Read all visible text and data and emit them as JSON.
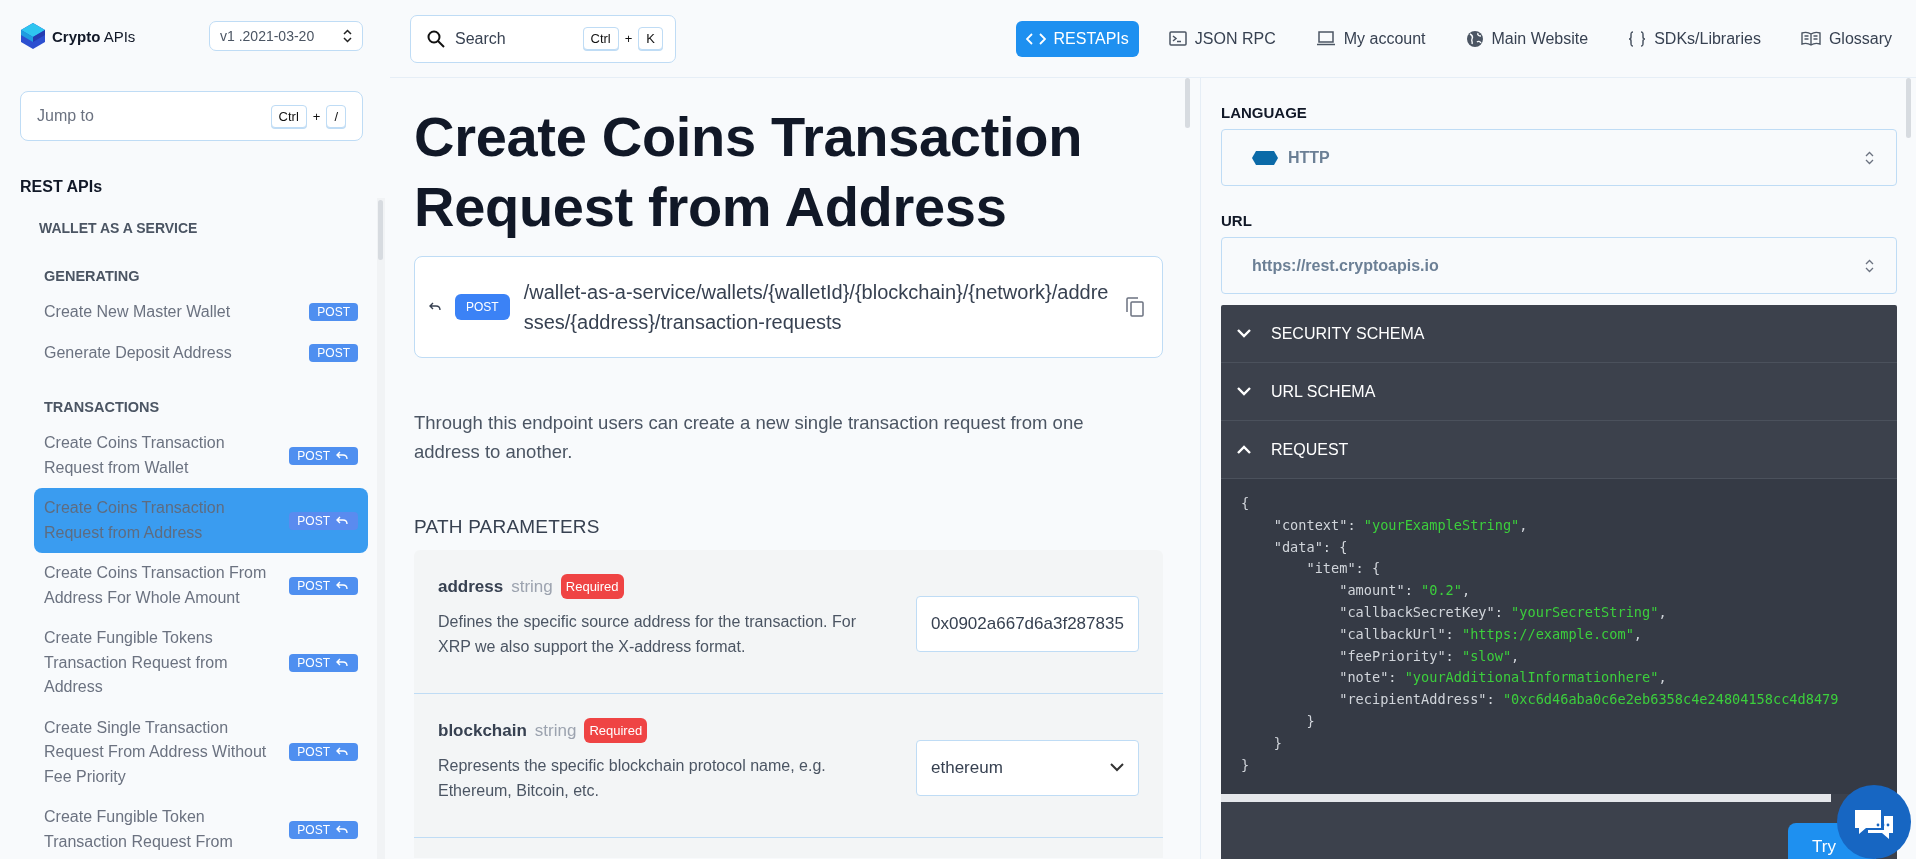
{
  "sidebar": {
    "logo": "**Crypto** APIs",
    "version": "v1 .2021-03-20",
    "jump": {
      "placeholder": "Jump to",
      "keys": [
        "Ctrl",
        "/"
      ],
      "separator": "+"
    },
    "section": "REST APIs",
    "tree": [
      {
        "label": "WALLET AS A SERVICE",
        "children": [
          {
            "label": "GENERATING",
            "children": [
              {
                "label": "Create New Master Wallet",
                "method": "POST",
                "callback": false,
                "selected": false
              },
              {
                "label": "Generate Deposit Address",
                "method": "POST",
                "callback": false,
                "selected": false
              }
            ]
          },
          {
            "label": "TRANSACTIONS",
            "children": [
              {
                "label": "Create Coins Transaction Request from Wallet",
                "method": "POST",
                "callback": true,
                "selected": false
              },
              {
                "label": "Create Coins Transaction Request from Address",
                "method": "POST",
                "callback": true,
                "selected": true
              },
              {
                "label": "Create Coins Transaction From Address For Whole Amount",
                "method": "POST",
                "callback": true,
                "selected": false
              },
              {
                "label": "Create Fungible Tokens Transaction Request from Address",
                "method": "POST",
                "callback": true,
                "selected": false
              },
              {
                "label": "Create Single Transaction Request From Address Without Fee Priority",
                "method": "POST",
                "callback": true,
                "selected": false
              },
              {
                "label": "Create Fungible Token Transaction Request From",
                "method": "POST",
                "callback": true,
                "selected": false
              }
            ]
          }
        ]
      }
    ]
  },
  "topbar": {
    "search": {
      "placeholder": "Search",
      "keys": [
        "Ctrl",
        "K"
      ],
      "separator": "+"
    },
    "nav": [
      {
        "label": "RESTAPIs",
        "kind": "code",
        "selected": true
      },
      {
        "label": "JSON RPC",
        "kind": "terminal",
        "selected": false
      },
      {
        "label": "My account",
        "kind": "laptop",
        "selected": false
      },
      {
        "label": "Main Website",
        "kind": "globe",
        "selected": false
      },
      {
        "label": "SDKs/Libraries",
        "kind": "braces",
        "selected": false
      },
      {
        "label": "Glossary",
        "kind": "book",
        "selected": false
      }
    ]
  },
  "main": {
    "title": "Create Coins Transaction Request from Address",
    "endpoint": {
      "method": "POST",
      "path": "/wallet-as-a-service/wallets/{walletId}/{blockchain}/{network}/addresses/{address}/transaction-requests"
    },
    "description": "Through this endpoint users can create a new single transaction request from one address to another.",
    "params_heading": "PATH PARAMETERS",
    "params": [
      {
        "name": "address",
        "type": "string",
        "badge": "Required",
        "description": "Defines the specific source address for the transaction. For XRP we also support the X-address format.",
        "kind": "input",
        "value": "0x0902a667d6a3f287835"
      },
      {
        "name": "blockchain",
        "type": "string",
        "badge": "Required",
        "description": "Represents the specific blockchain protocol name, e.g. Ethereum, Bitcoin, etc.",
        "kind": "select",
        "value": "ethereum"
      }
    ]
  },
  "panel": {
    "language": {
      "label": "LANGUAGE",
      "value": "HTTP"
    },
    "url": {
      "label": "URL",
      "value": "https://rest.cryptoapis.io"
    },
    "sections": [
      {
        "title": "SECURITY SCHEMA",
        "expanded": false
      },
      {
        "title": "URL SCHEMA",
        "expanded": false
      },
      {
        "title": "REQUEST",
        "expanded": true
      }
    ],
    "code": [
      {
        "text": "{"
      },
      {
        "text": "    \"context\": ",
        "value": "\"yourExampleString\"",
        "tail": ","
      },
      {
        "text": "    \"data\": {"
      },
      {
        "text": "        \"item\": {"
      },
      {
        "text": "            \"amount\": ",
        "value": "\"0.2\"",
        "tail": ","
      },
      {
        "text": "            \"callbackSecretKey\": ",
        "value": "\"yourSecretString\"",
        "tail": ","
      },
      {
        "text": "            \"callbackUrl\": ",
        "value": "\"https://example.com\"",
        "tail": ","
      },
      {
        "text": "            \"feePriority\": ",
        "value": "\"slow\"",
        "tail": ","
      },
      {
        "text": "            \"note\": ",
        "value": "\"yourAdditionalInformationhere\"",
        "tail": ","
      },
      {
        "text": "            \"recipientAddress\": ",
        "value": "\"0xc6d46aba0c6e2eb6358c4e24804158cc4d8479"
      },
      {
        "text": "        }"
      },
      {
        "text": "    }"
      },
      {
        "text": "}"
      }
    ],
    "try_button": "Try"
  }
}
